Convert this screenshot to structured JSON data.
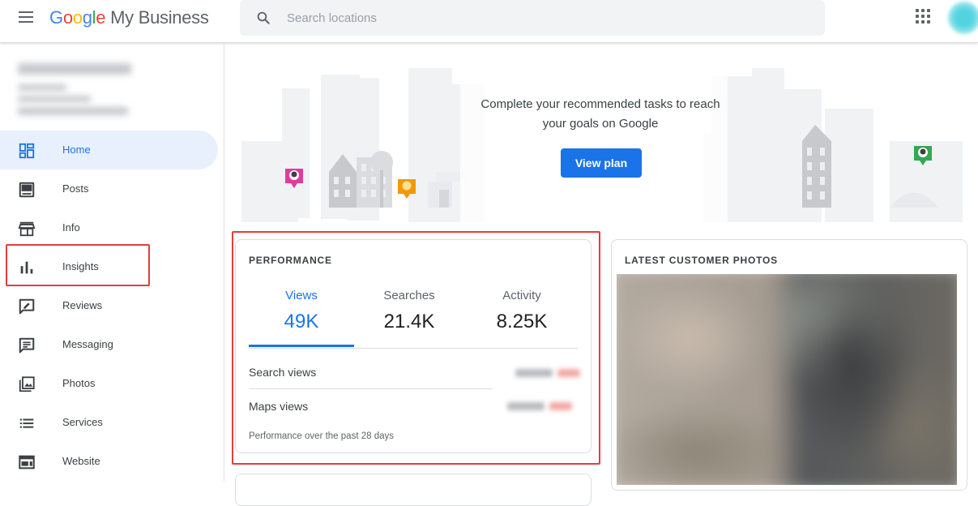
{
  "app": {
    "logo_letters": [
      "G",
      "o",
      "o",
      "g",
      "l",
      "e"
    ],
    "product": "My Business"
  },
  "search": {
    "placeholder": "Search locations"
  },
  "sidebar": {
    "items": [
      {
        "label": "Home",
        "icon": "dashboard-icon",
        "active": true
      },
      {
        "label": "Posts",
        "icon": "posts-icon",
        "active": false
      },
      {
        "label": "Info",
        "icon": "storefront-icon",
        "active": false
      },
      {
        "label": "Insights",
        "icon": "bar-chart-icon",
        "active": false
      },
      {
        "label": "Reviews",
        "icon": "reviews-icon",
        "active": false
      },
      {
        "label": "Messaging",
        "icon": "message-icon",
        "active": false
      },
      {
        "label": "Photos",
        "icon": "photos-icon",
        "active": false
      },
      {
        "label": "Services",
        "icon": "list-icon",
        "active": false
      },
      {
        "label": "Website",
        "icon": "website-icon",
        "active": false
      }
    ]
  },
  "banner": {
    "text_line1": "Complete your recommended tasks to reach",
    "text_line2": "your goals on Google",
    "button": "View plan"
  },
  "performance": {
    "title": "PERFORMANCE",
    "tabs": [
      {
        "label": "Views",
        "value": "49K",
        "active": true
      },
      {
        "label": "Searches",
        "value": "21.4K",
        "active": false
      },
      {
        "label": "Activity",
        "value": "8.25K",
        "active": false
      }
    ],
    "rows": [
      {
        "label": "Search views"
      },
      {
        "label": "Maps views"
      }
    ],
    "footnote": "Performance over the past 28 days"
  },
  "photos": {
    "title": "LATEST CUSTOMER PHOTOS"
  },
  "colors": {
    "accent": "#1a73e8",
    "highlight": "#e23d3d",
    "active_bg": "#e8f0fe"
  }
}
